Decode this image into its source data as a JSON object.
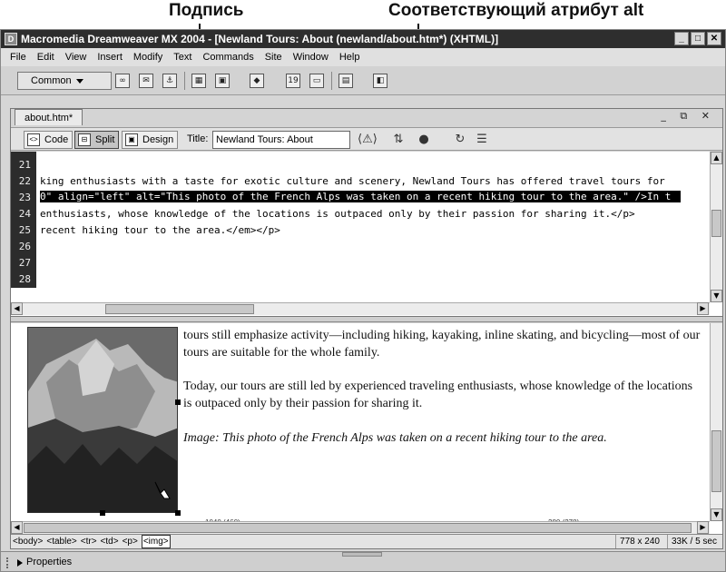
{
  "callouts": {
    "caption": "Подпись",
    "alt": "Соответствующий атрибут alt"
  },
  "window": {
    "title": "Macromedia Dreamweaver MX 2004 - [Newland Tours: About (newland/about.htm*) (XHTML)]"
  },
  "menu": [
    "File",
    "Edit",
    "View",
    "Insert",
    "Modify",
    "Text",
    "Commands",
    "Site",
    "Window",
    "Help"
  ],
  "insert_bar": {
    "category": "Common",
    "icons": [
      "hyperlink-icon",
      "email-link-icon",
      "named-anchor-icon",
      "table-icon",
      "image-icon",
      "media-icon",
      "date-icon",
      "comment-icon",
      "templates-icon",
      "tag-chooser-icon"
    ]
  },
  "document": {
    "tab": "about.htm*",
    "view_buttons": {
      "code": "Code",
      "split": "Split",
      "design": "Design"
    },
    "active_view": "Split",
    "title_label": "Title:",
    "title_value": "Newland Tours: About",
    "code_lines": [
      {
        "num": "21",
        "text": ""
      },
      {
        "num": "22",
        "text": "king enthusiasts with a taste for exotic culture and scenery, Newland Tours has offered travel tours for"
      },
      {
        "num": "23",
        "text": "0\" align=\"left\" alt=\"This photo of the French Alps was taken on a recent hiking tour to the area.\" />In t",
        "selected": true
      },
      {
        "num": "24",
        "text": "enthusiasts, whose knowledge of the locations is outpaced only by their passion for sharing it.</p>"
      },
      {
        "num": "25",
        "text": "recent hiking tour to the area.</em></p>"
      },
      {
        "num": "26",
        "text": ""
      },
      {
        "num": "27",
        "text": ""
      },
      {
        "num": "28",
        "text": ""
      }
    ],
    "design": {
      "para1": "tours still emphasize activity—including hiking, kayaking, inline skating, and bicycling—most of our tours are suitable for the whole family.",
      "para2": "Today, our tours are still led by experienced traveling enthusiasts, whose knowledge of the locations is outpaced only by their passion for sharing it.",
      "caption": "Image: This photo of the French Alps was taken on a recent hiking tour to the area.",
      "ruler_left": "1040 (460)",
      "ruler_right": "280 (278)"
    },
    "status": {
      "tags": [
        "<body>",
        "<table>",
        "<tr>",
        "<td>",
        "<p>",
        "<img>"
      ],
      "active_tag": "<img>",
      "window_size": "778 x 240",
      "download": "33K / 5 sec"
    }
  },
  "properties_panel": {
    "label": "Properties"
  },
  "colors": {
    "titlebar": "#2e2e2e",
    "selection": "#000000",
    "gutter": "#2c2c2c"
  }
}
